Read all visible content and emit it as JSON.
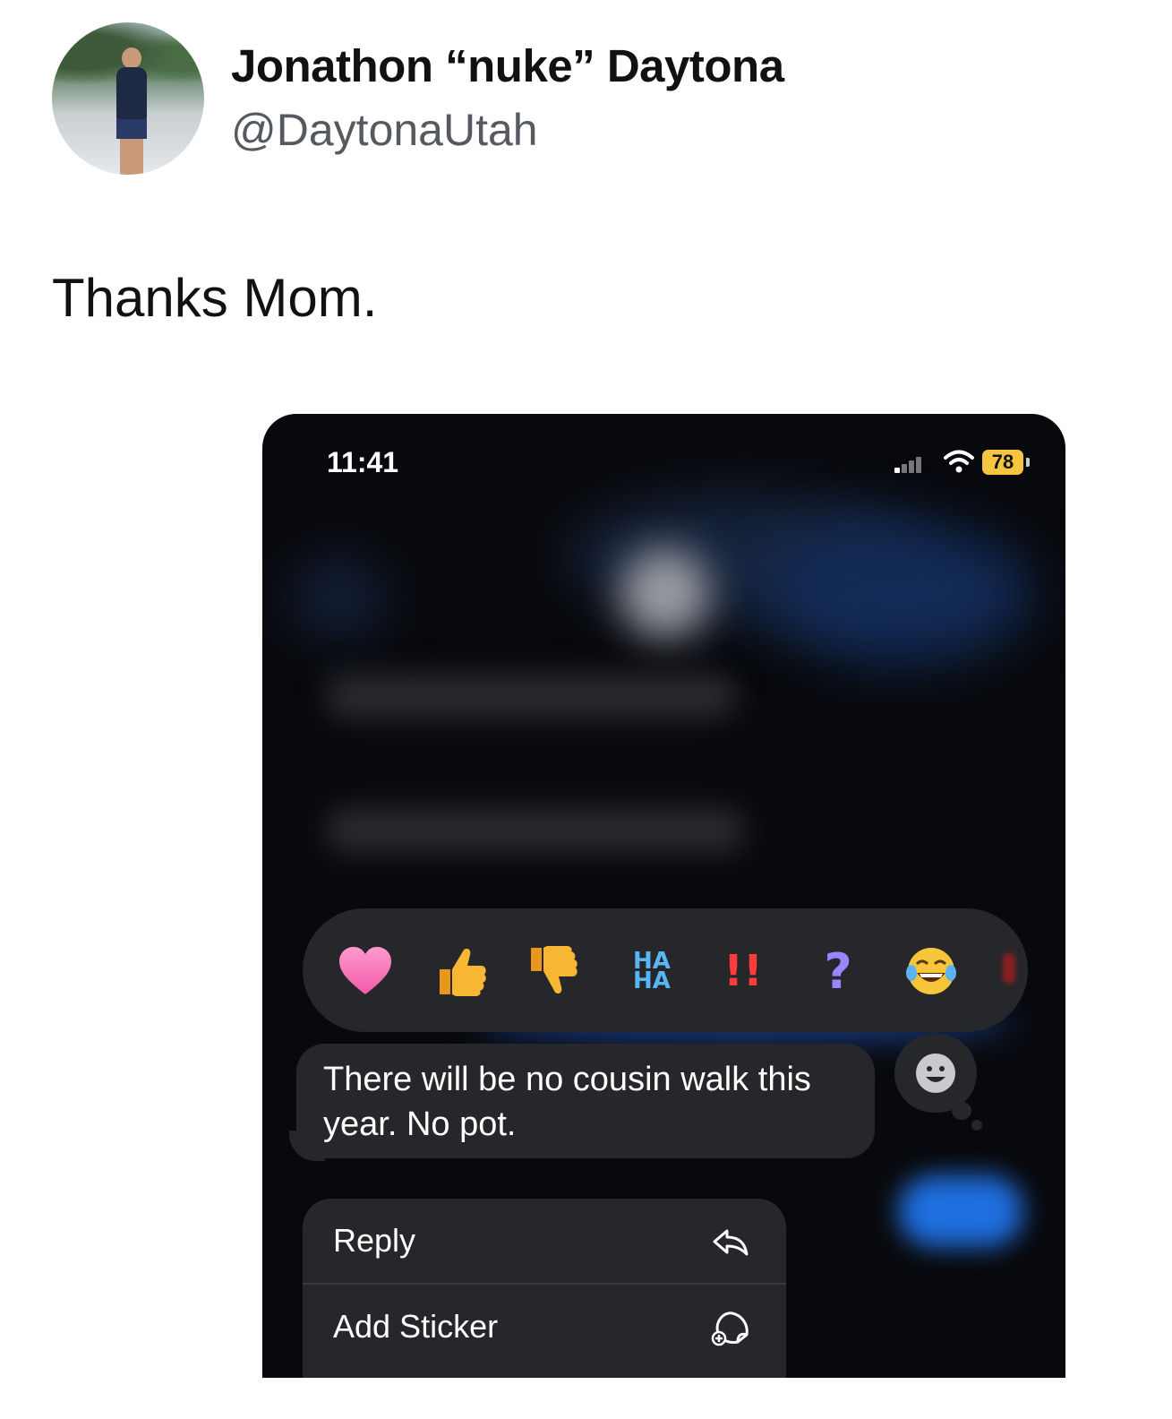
{
  "tweet": {
    "display_name": "Jonathon “nuke” Daytona",
    "handle": "@DaytonaUtah",
    "text": "Thanks Mom."
  },
  "phone": {
    "status_time": "11:41",
    "battery": "78",
    "reactions": [
      {
        "name": "heart"
      },
      {
        "name": "thumbs-up"
      },
      {
        "name": "thumbs-down"
      },
      {
        "name": "haha",
        "label_top": "HA",
        "label_bottom": "HA"
      },
      {
        "name": "exclamation",
        "label": "!!"
      },
      {
        "name": "question",
        "label": "?"
      },
      {
        "name": "laughing-emoji"
      }
    ],
    "message": "There will be no cousin walk this year. No pot.",
    "menu": [
      {
        "label": "Reply",
        "icon": "reply-icon"
      },
      {
        "label": "Add Sticker",
        "icon": "add-sticker-icon"
      }
    ]
  },
  "colors": {
    "phone_bg": "#08090c",
    "bubble_bg": "#26272b",
    "battery": "#f5c542",
    "accent_blue": "#1f6fe0"
  }
}
